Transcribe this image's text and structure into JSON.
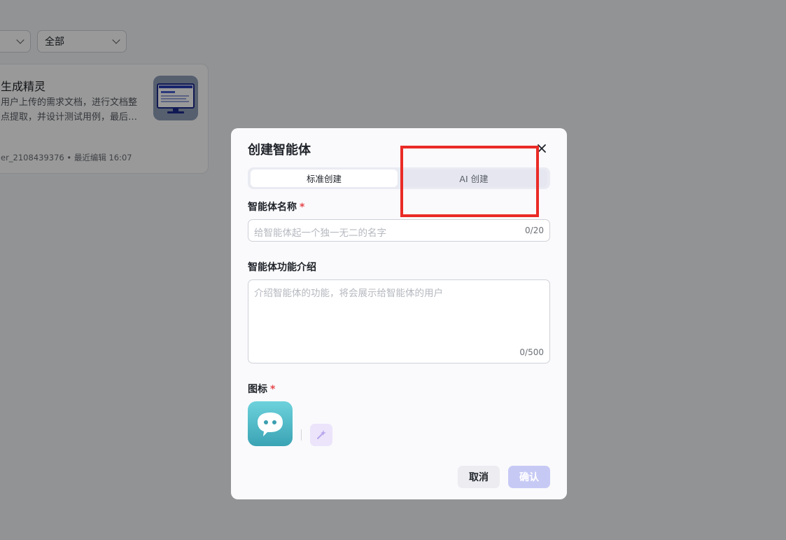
{
  "background": {
    "filters": {
      "first_select": "",
      "second_select": "全部"
    },
    "bot_card": {
      "title": "生成精灵",
      "description": "用户上传的需求文档，进行文档整\n点提取，并设计测试用例，最后…",
      "meta": "er_2108439376 • 最近编辑 16:07"
    }
  },
  "modal": {
    "title": "创建智能体",
    "tabs": [
      {
        "label": "标准创建",
        "active": true
      },
      {
        "label": "AI 创建",
        "active": false
      }
    ],
    "name_field": {
      "label": "智能体名称",
      "required_mark": "*",
      "placeholder": "给智能体起一个独一无二的名字",
      "counter": "0/20"
    },
    "desc_field": {
      "label": "智能体功能介绍",
      "placeholder": "介绍智能体的功能，将会展示给智能体的用户",
      "counter": "0/500"
    },
    "icon_field": {
      "label": "图标",
      "required_mark": "*"
    },
    "buttons": {
      "cancel": "取消",
      "confirm": "确认"
    }
  },
  "colors": {
    "accent_disabled": "#c7c9f5",
    "annotation_red": "#ea2b26",
    "avatar_gradient_top": "#6dd2dc",
    "avatar_gradient_bottom": "#3aa3b4"
  }
}
